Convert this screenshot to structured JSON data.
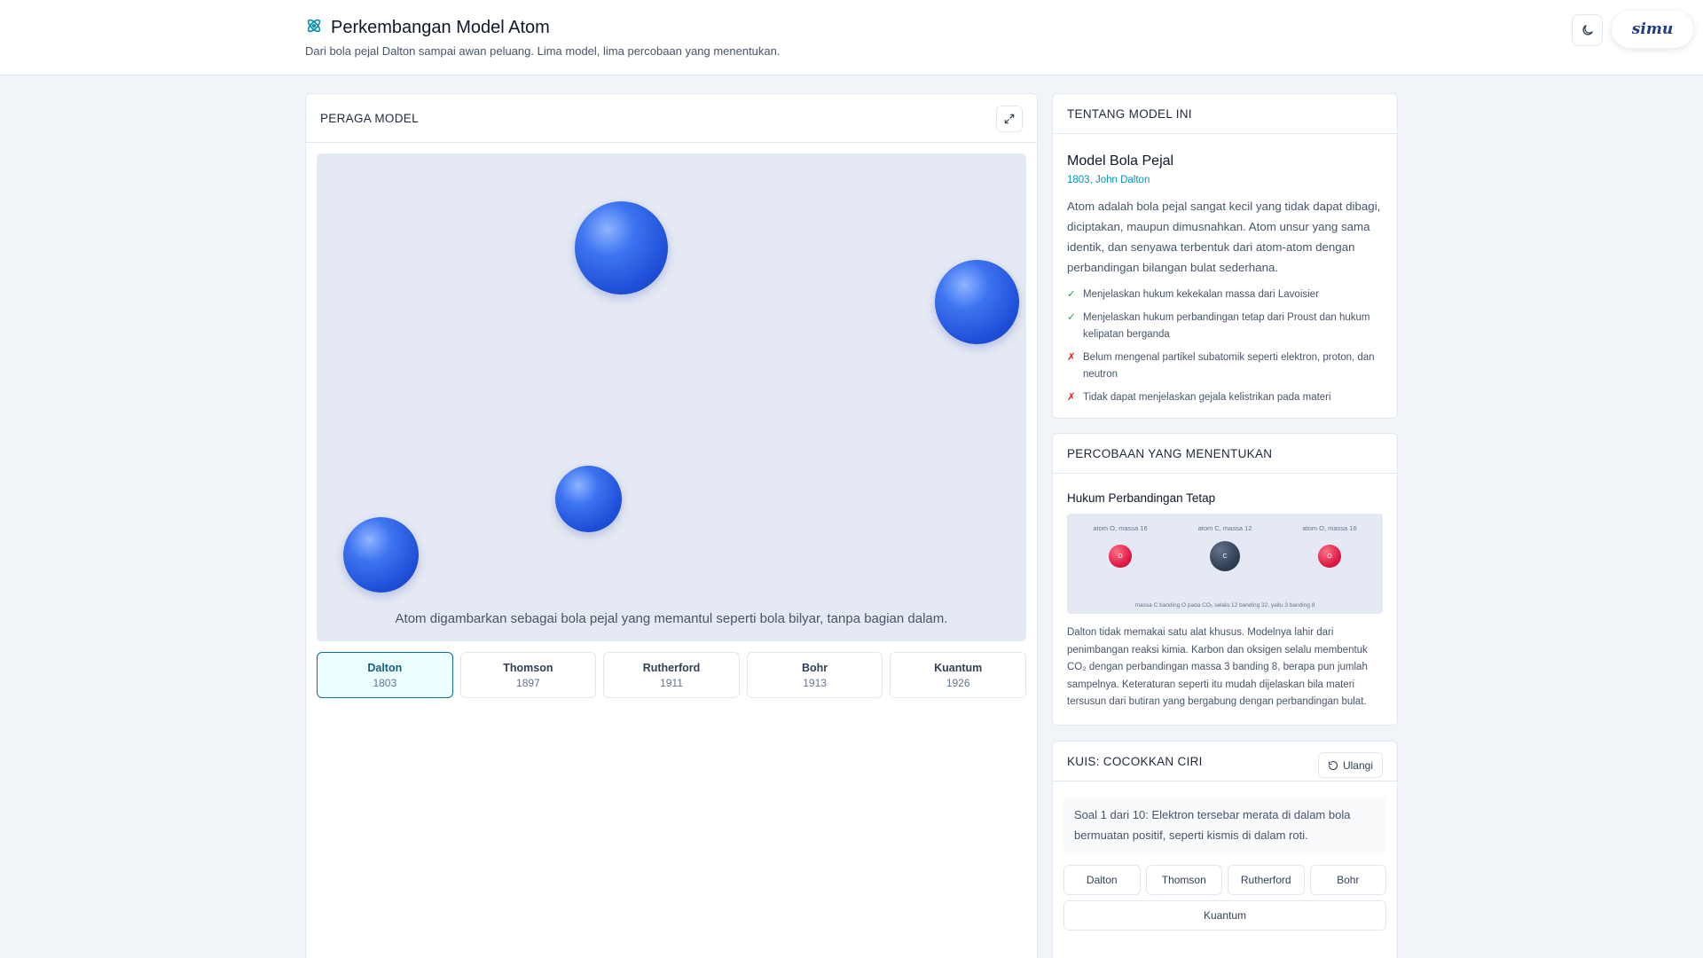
{
  "header": {
    "title": "Perkembangan Model Atom",
    "subtitle": "Dari bola pejal Dalton sampai awan peluang. Lima model, lima percobaan yang menentukan.",
    "logo_text": "simu"
  },
  "viewer": {
    "heading": "PERAGA MODEL",
    "caption": "Atom digambarkan sebagai bola pejal yang memantul seperti bola bilyar, tanpa bagian dalam.",
    "models": [
      {
        "name": "Dalton",
        "year": "1803",
        "active": true
      },
      {
        "name": "Thomson",
        "year": "1897",
        "active": false
      },
      {
        "name": "Rutherford",
        "year": "1911",
        "active": false
      },
      {
        "name": "Bohr",
        "year": "1913",
        "active": false
      },
      {
        "name": "Kuantum",
        "year": "1926",
        "active": false
      }
    ]
  },
  "about": {
    "heading": "TENTANG MODEL INI",
    "model_name": "Model Bola Pejal",
    "meta": "1803, John Dalton",
    "description": "Atom adalah bola pejal sangat kecil yang tidak dapat dibagi, diciptakan, maupun dimusnahkan. Atom unsur yang sama identik, dan senyawa terbentuk dari atom-atom dengan perbandingan bilangan bulat sederhana.",
    "points": [
      {
        "type": "pro",
        "mark": "✓",
        "text": "Menjelaskan hukum kekekalan massa dari Lavoisier"
      },
      {
        "type": "pro",
        "mark": "✓",
        "text": "Menjelaskan hukum perbandingan tetap dari Proust dan hukum kelipatan berganda"
      },
      {
        "type": "con",
        "mark": "✗",
        "text": "Belum mengenal partikel subatomik seperti elektron, proton, dan neutron"
      },
      {
        "type": "con",
        "mark": "✗",
        "text": "Tidak dapat menjelaskan gejala kelistrikan pada materi"
      }
    ]
  },
  "experiment": {
    "heading": "PERCOBAAN YANG MENENTUKAN",
    "title": "Hukum Perbandingan Tetap",
    "viz": {
      "atoms": [
        {
          "label": "atom O, massa 16",
          "symbol": "O"
        },
        {
          "label": "atom C, massa 12",
          "symbol": "C"
        },
        {
          "label": "atom O, massa 16",
          "symbol": "O"
        }
      ],
      "footer": "massa C banding O pada CO₂ selalu 12 banding 32, yaitu 3 banding 8"
    },
    "description": "Dalton tidak memakai satu alat khusus. Modelnya lahir dari penimbangan reaksi kimia. Karbon dan oksigen selalu membentuk CO₂ dengan perbandingan massa 3 banding 8, berapa pun jumlah sampelnya. Keteraturan seperti itu mudah dijelaskan bila materi tersusun dari butiran yang bergabung dengan perbandingan bulat."
  },
  "quiz": {
    "heading": "KUIS: COCOKKAN CIRI",
    "reset_label": "Ulangi",
    "question": "Soal 1 dari 10: Elektron tersebar merata di dalam bola bermuatan positif, seperti kismis di dalam roti.",
    "options": [
      "Dalton",
      "Thomson",
      "Rutherford",
      "Bohr",
      "Kuantum"
    ]
  },
  "colors": {
    "accent": "#0e7490",
    "ball": "#2563eb",
    "oxygen": "#e11d48",
    "carbon": "#334155",
    "pro": "#16a34a",
    "con": "#dc2626"
  }
}
